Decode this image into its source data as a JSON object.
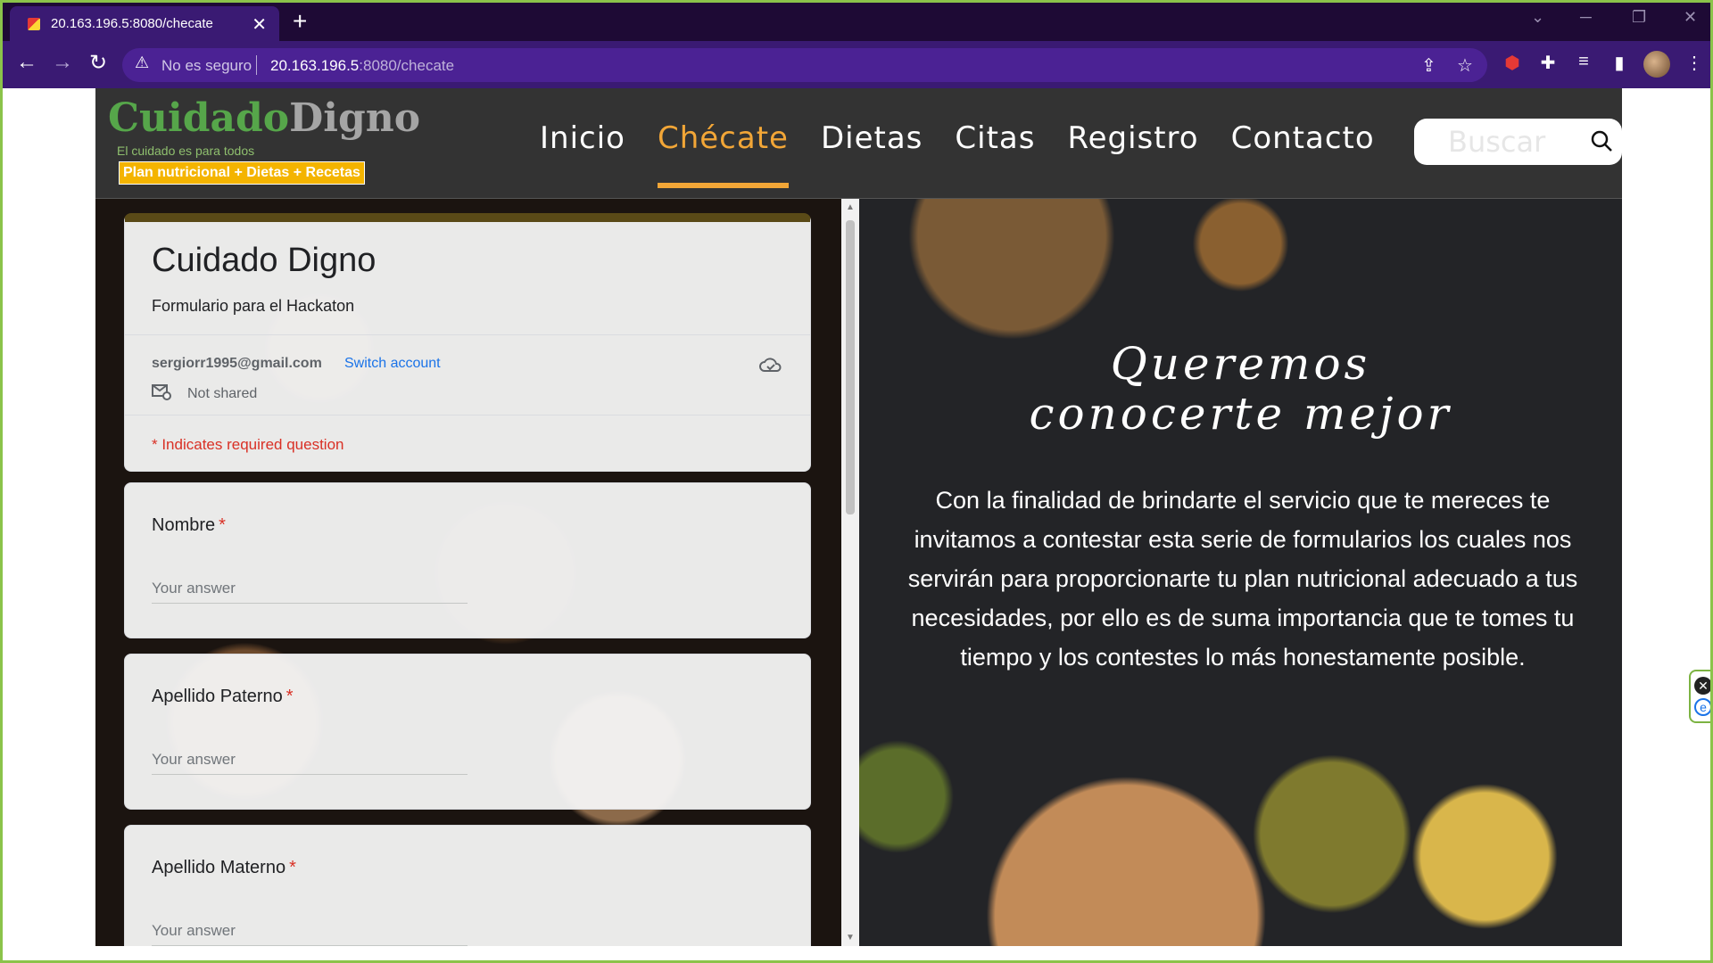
{
  "browser": {
    "tab_title": "20.163.196.5:8080/checate",
    "security_label": "No es seguro",
    "url_host": "20.163.196.5",
    "url_path": ":8080/checate"
  },
  "site": {
    "logo_part1": "Cuidado",
    "logo_part2": "Digno",
    "tagline": "El cuidado es para todos",
    "promo": "Plan nutricional + Dietas + Recetas",
    "nav": [
      "Inicio",
      "Chécate",
      "Dietas",
      "Citas",
      "Registro",
      "Contacto"
    ],
    "active_nav": "Chécate",
    "search_placeholder": "Buscar"
  },
  "form": {
    "title": "Cuidado Digno",
    "description": "Formulario para el Hackaton",
    "email": "sergiorr1995@gmail.com",
    "switch_account": "Switch account",
    "not_shared": "Not shared",
    "required_note": "* Indicates required question",
    "questions": [
      {
        "label": "Nombre",
        "placeholder": "Your answer"
      },
      {
        "label": "Apellido Paterno",
        "placeholder": "Your answer"
      },
      {
        "label": "Apellido Materno",
        "placeholder": "Your answer"
      }
    ],
    "accent_color": "#5a4a17"
  },
  "info": {
    "heading_line1": "Queremos",
    "heading_line2": "conocerte mejor",
    "body": "Con la finalidad de brindarte el servicio que te mereces te invitamos a contestar esta serie de formularios los cuales nos servirán para proporcionarte tu plan nutricional adecuado a tus necesidades, por ello  es de suma importancia que te tomes tu tiempo y los contestes lo más honestamente posible."
  },
  "colors": {
    "brand_green": "#56a64a",
    "nav_active": "#f2a637",
    "promo_bg": "#f4b400",
    "required_red": "#d93025",
    "link_blue": "#1a73e8"
  }
}
